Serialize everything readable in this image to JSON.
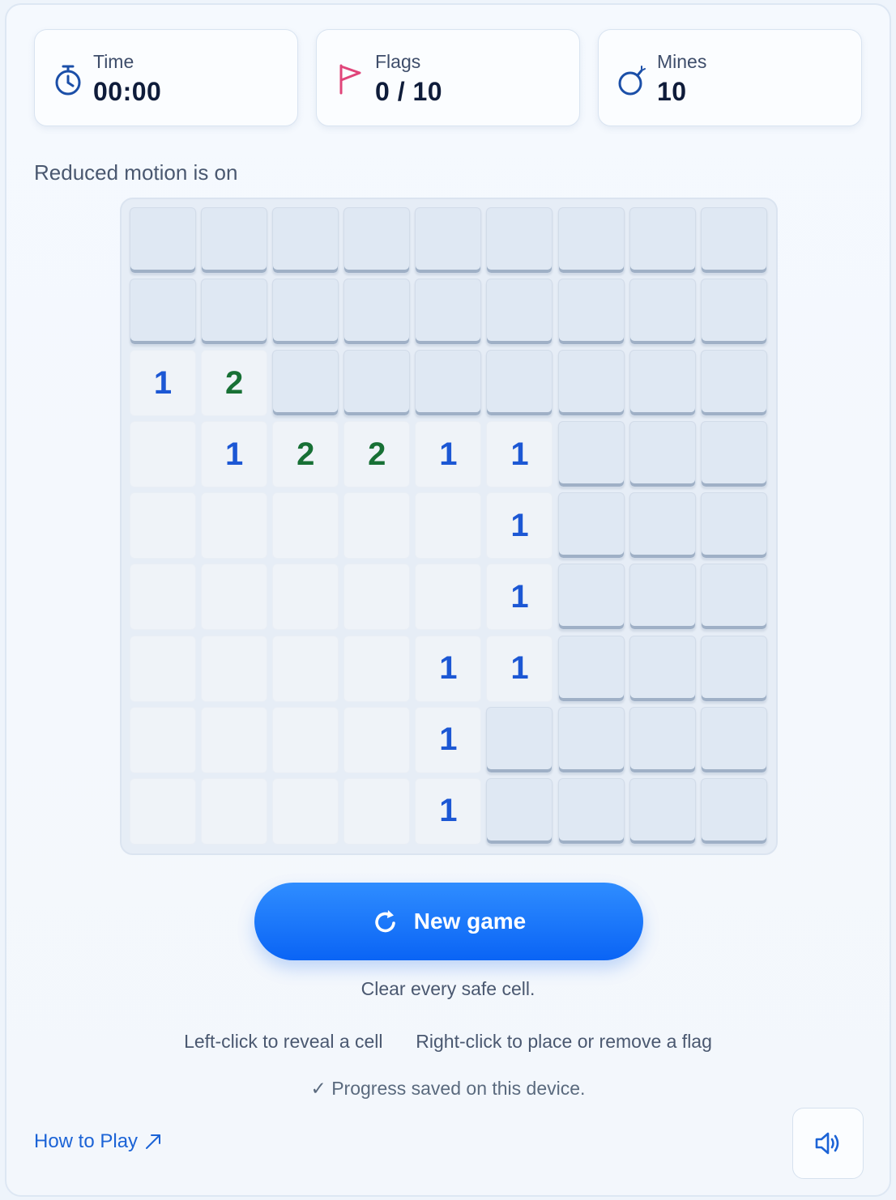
{
  "stats": {
    "time": {
      "label": "Time",
      "value": "00:00",
      "icon": "stopwatch-icon"
    },
    "flags": {
      "label": "Flags",
      "value": "0 / 10",
      "icon": "flag-icon"
    },
    "mines": {
      "label": "Mines",
      "value": "10",
      "icon": "bomb-icon"
    }
  },
  "status_text": "Reduced motion is on",
  "board": {
    "rows": 9,
    "cols": 9,
    "cells": [
      [
        "h",
        "h",
        "h",
        "h",
        "h",
        "h",
        "h",
        "h",
        "h"
      ],
      [
        "h",
        "h",
        "h",
        "h",
        "h",
        "h",
        "h",
        "h",
        "h"
      ],
      [
        "1",
        "2",
        "h",
        "h",
        "h",
        "h",
        "h",
        "h",
        "h"
      ],
      [
        "0",
        "1",
        "2",
        "2",
        "1",
        "1",
        "h",
        "h",
        "h"
      ],
      [
        "0",
        "0",
        "0",
        "0",
        "0",
        "1",
        "h",
        "h",
        "h"
      ],
      [
        "0",
        "0",
        "0",
        "0",
        "0",
        "1",
        "h",
        "h",
        "h"
      ],
      [
        "0",
        "0",
        "0",
        "0",
        "1",
        "1",
        "h",
        "h",
        "h"
      ],
      [
        "0",
        "0",
        "0",
        "0",
        "1",
        "h",
        "h",
        "h",
        "h"
      ],
      [
        "0",
        "0",
        "0",
        "0",
        "1",
        "h",
        "h",
        "h",
        "h"
      ]
    ]
  },
  "new_game": {
    "label": "New game",
    "icon": "refresh-icon"
  },
  "instructions": {
    "goal": "Clear every safe cell.",
    "left_click": "Left-click to reveal a cell",
    "right_click": "Right-click to place or remove a flag",
    "saved": "✓ Progress saved on this device."
  },
  "how_to_play": {
    "label": "How to Play",
    "icon": "external-arrow-icon"
  },
  "sound_button": {
    "icon": "speaker-icon"
  },
  "colors": {
    "accent": "#0a64f5",
    "number_1": "#1c57d4",
    "number_2": "#177035",
    "flag": "#e0457a"
  }
}
